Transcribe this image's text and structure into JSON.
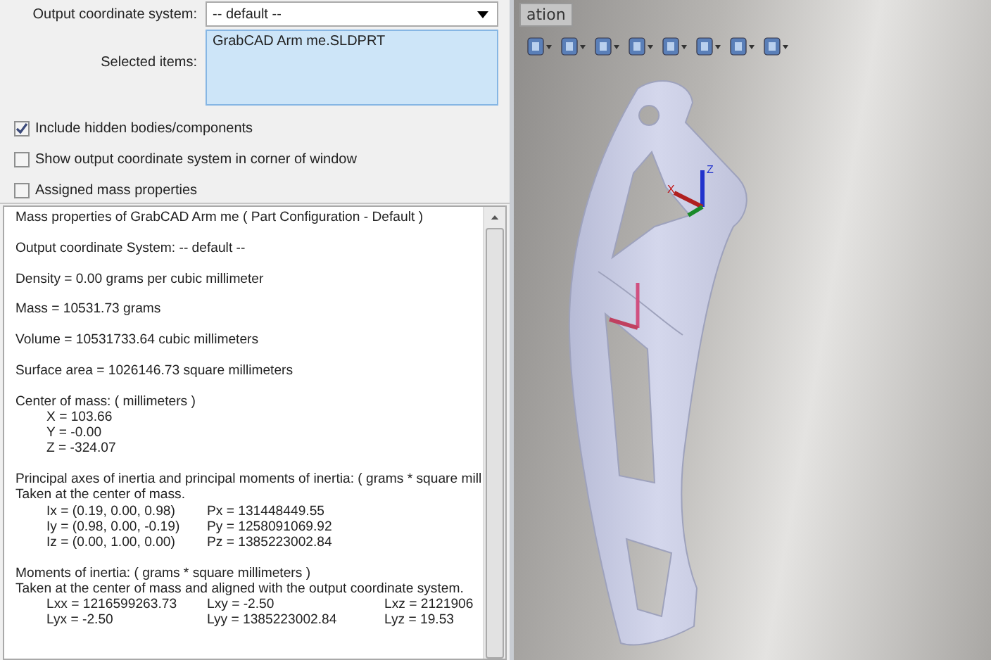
{
  "options": {
    "coordinate_label": "Output coordinate system:",
    "coordinate_value": "-- default --",
    "selected_label": "Selected items:",
    "selected_items": [
      "GrabCAD Arm me.SLDPRT"
    ],
    "checkboxes": [
      {
        "label": "Include hidden bodies/components",
        "checked": true
      },
      {
        "label": "Show output coordinate system in corner of window",
        "checked": false
      },
      {
        "label": "Assigned mass properties",
        "checked": false
      }
    ]
  },
  "results": [
    {
      "lines": [
        "Mass properties of GrabCAD Arm me ( Part Configuration - Default )"
      ]
    },
    {
      "lines": [
        "Output  coordinate System: -- default --"
      ]
    },
    {
      "lines": [
        "Density = 0.00 grams per  cubic millimeter"
      ]
    },
    {
      "lines": [
        "Mass = 10531.73 grams"
      ]
    },
    {
      "lines": [
        "Volume = 10531733.64  cubic millimeters"
      ]
    },
    {
      "lines": [
        "Surface area = 1026146.73  square millimeters"
      ]
    },
    {
      "lines": [
        "Center of mass: ( millimeters )"
      ],
      "rows": [
        [
          "X = 103.66"
        ],
        [
          "Y = -0.00"
        ],
        [
          "Z = -324.07"
        ]
      ]
    },
    {
      "lines": [
        "Principal axes of inertia and principal moments of inertia: ( grams *  square mill",
        "Taken at the center of mass."
      ],
      "rows": [
        [
          "Ix = (0.19, 0.00, 0.98)",
          "Px = 131448449.55"
        ],
        [
          "Iy = (0.98, 0.00, -0.19)",
          "Py = 1258091069.92"
        ],
        [
          "Iz = (0.00, 1.00, 0.00)",
          "Pz = 1385223002.84"
        ]
      ]
    },
    {
      "lines": [
        "Moments of inertia: ( grams *  square millimeters )",
        "Taken at the center of mass and aligned with the output coordinate system."
      ],
      "rows": [
        [
          "Lxx = 1216599263.73",
          "Lxy = -2.50",
          "Lxz = 2121906"
        ],
        [
          "Lyx = -2.50",
          "Lyy = 1385223002.84",
          "Lyz = 19.53"
        ]
      ]
    }
  ],
  "viewport": {
    "tab": "ation",
    "triad_labels": [
      "X",
      "Z"
    ]
  }
}
